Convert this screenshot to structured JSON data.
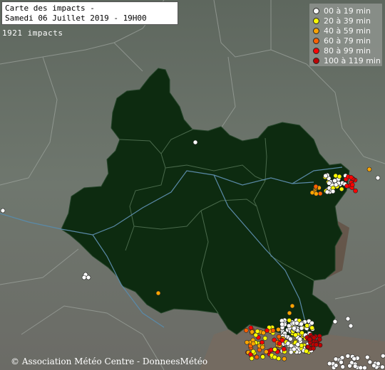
{
  "title": {
    "line1": "Carte des impacts -",
    "line2": "Samedi 06 Juillet 2019 - 19H00"
  },
  "impact_count": "1921 impacts",
  "legend": [
    {
      "label": "00 à 19 min",
      "color": "#ffffff"
    },
    {
      "label": "20 à 39 min",
      "color": "#ffff00"
    },
    {
      "label": "40 à 59 min",
      "color": "#ffa500"
    },
    {
      "label": "60 à 79 min",
      "color": "#ff6000"
    },
    {
      "label": "80 à 99 min",
      "color": "#ff0000"
    },
    {
      "label": "100 à 119 min",
      "color": "#c00000"
    }
  ],
  "credit": "© Association Météo Centre - DonneesMétéo",
  "colors": {
    "background": "#6e766e",
    "region": "#0d2b10",
    "river": "#5a8aa8",
    "border": "#9aa09a"
  }
}
